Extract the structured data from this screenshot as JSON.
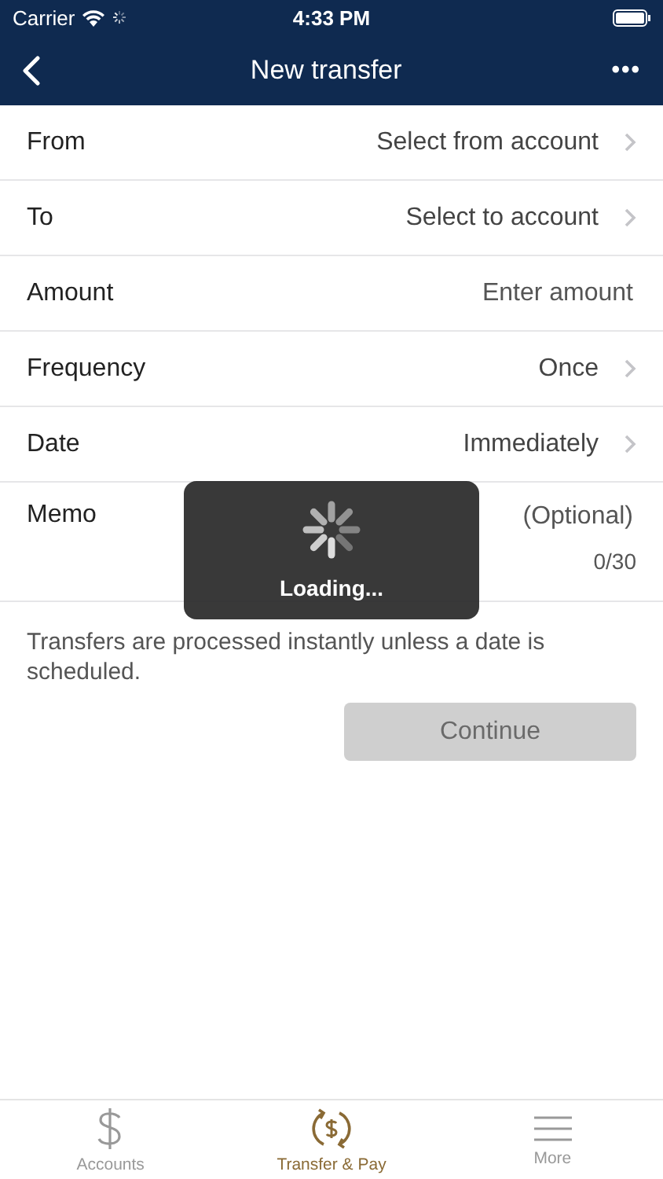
{
  "status_bar": {
    "carrier": "Carrier",
    "time": "4:33 PM"
  },
  "nav": {
    "title": "New transfer",
    "more": "•••"
  },
  "rows": [
    {
      "kind": "select",
      "label": "From",
      "value": "Select from account"
    },
    {
      "kind": "select",
      "label": "To",
      "value": "Select to account"
    },
    {
      "kind": "input",
      "label": "Amount",
      "placeholder": "Enter amount"
    },
    {
      "kind": "select",
      "label": "Frequency",
      "value": "Once"
    },
    {
      "kind": "select",
      "label": "Date",
      "value": "Immediately"
    },
    {
      "kind": "memo",
      "label": "Memo",
      "placeholder": "(Optional)",
      "counter": "0/30"
    }
  ],
  "note": "Transfers are processed instantly unless a date is scheduled.",
  "continue_button": {
    "label": "Continue",
    "disabled": true
  },
  "loading": {
    "label": "Loading..."
  },
  "tabs": [
    {
      "kind": "dollar",
      "label": "Accounts",
      "selected": false
    },
    {
      "kind": "transfer",
      "label": "Transfer & Pay",
      "selected": true
    },
    {
      "kind": "menu",
      "label": "More",
      "selected": false
    }
  ]
}
